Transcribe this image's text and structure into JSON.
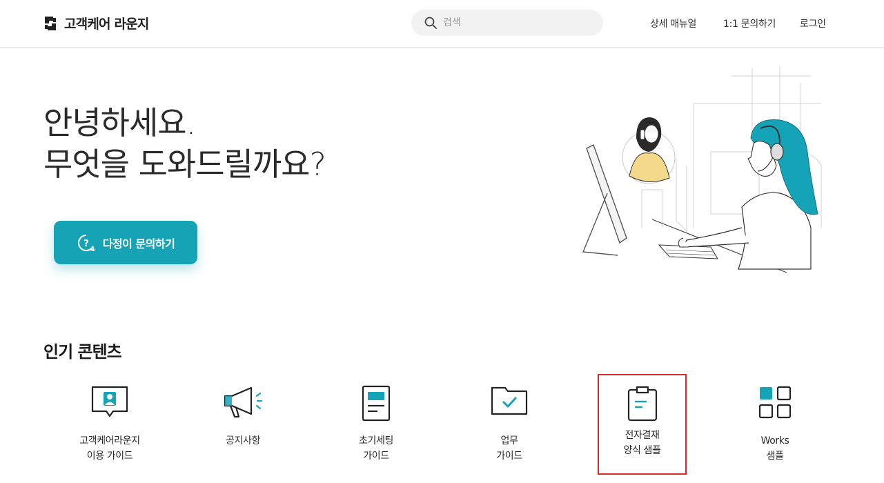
{
  "header": {
    "logo_text": "고객케어 라운지",
    "search_placeholder": "검색",
    "nav": {
      "manual": "상세 매뉴얼",
      "inquiry": "1:1 문의하기",
      "login": "로그인"
    }
  },
  "hero": {
    "title_line1": "안녕하세요.",
    "title_line2": "무엇을 도와드릴까요?",
    "cta_label": "다정이 문의하기"
  },
  "popular": {
    "title": "인기 콘텐츠",
    "items": [
      {
        "line1": "고객케어라운지",
        "line2": "이용 가이드",
        "icon": "monitor-user-icon"
      },
      {
        "line1": "공지사항",
        "line2": "",
        "icon": "megaphone-icon"
      },
      {
        "line1": "초기세팅",
        "line2": "가이드",
        "icon": "document-icon"
      },
      {
        "line1": "업무",
        "line2": "가이드",
        "icon": "folder-check-icon"
      },
      {
        "line1": "전자결재",
        "line2": "양식 샘플",
        "icon": "clipboard-icon"
      },
      {
        "line1": "Works",
        "line2": "샘플",
        "icon": "grid-icon"
      }
    ]
  },
  "colors": {
    "accent": "#16a3b6",
    "selected_outline": "#d42b2b"
  }
}
